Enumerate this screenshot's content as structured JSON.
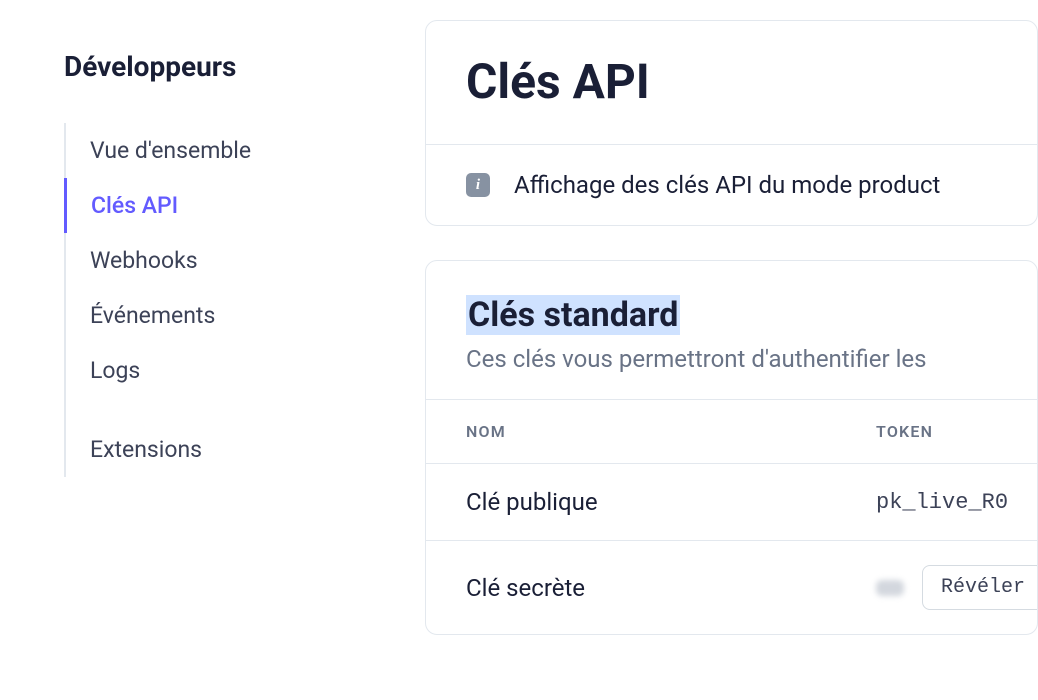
{
  "sidebar": {
    "title": "Développeurs",
    "items": [
      {
        "label": "Vue d'ensemble",
        "active": false
      },
      {
        "label": "Clés API",
        "active": true
      },
      {
        "label": "Webhooks",
        "active": false
      },
      {
        "label": "Événements",
        "active": false
      },
      {
        "label": "Logs",
        "active": false
      }
    ],
    "extra": [
      {
        "label": "Extensions",
        "active": false
      }
    ]
  },
  "main": {
    "page_title": "Clés API",
    "info_banner": "Affichage des clés API du mode product",
    "standard_keys": {
      "title": "Clés standard",
      "subtitle": "Ces clés vous permettront d'authentifier les",
      "columns": {
        "name": "NOM",
        "token": "TOKEN"
      },
      "rows": [
        {
          "name": "Clé publique",
          "token": "pk_live_R0"
        },
        {
          "name": "Clé secrète",
          "reveal_label": "Révéler"
        }
      ]
    }
  }
}
